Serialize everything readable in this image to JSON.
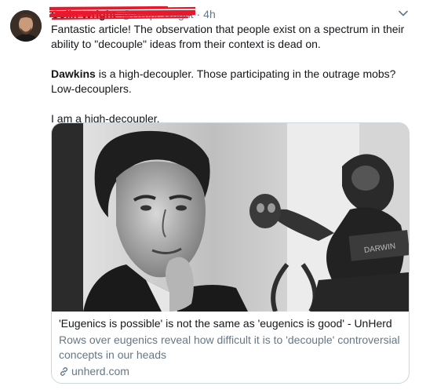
{
  "author": {
    "name": "Colin Wright",
    "handle": "@SwipeWright",
    "time": "4h"
  },
  "tweet": {
    "para1": "Fantastic article! The observation that people exist on a spectrum in their ability to \"decouple\" ideas from their context is dead on.",
    "para2_bold": "Dawkins",
    "para2_rest": " is a high-decoupler. Those participating in the outrage mobs? Low-decouplers.",
    "para3": "I am a high-decoupler."
  },
  "card": {
    "title": "'Eugenics is possible' is not the same as 'eugenics is good' - UnHerd",
    "description": "Rows over eugenics reveal how difficult it is to 'decouple' controversial concepts in our heads",
    "domain": "unherd.com",
    "image_sign_text": "DARWIN"
  },
  "colors": {
    "text": "#14171a",
    "secondary": "#657786",
    "border": "#ccd6dd",
    "redaction": "#e8192c"
  },
  "icons": {
    "caret": "chevron-down-icon",
    "link": "link-icon"
  }
}
